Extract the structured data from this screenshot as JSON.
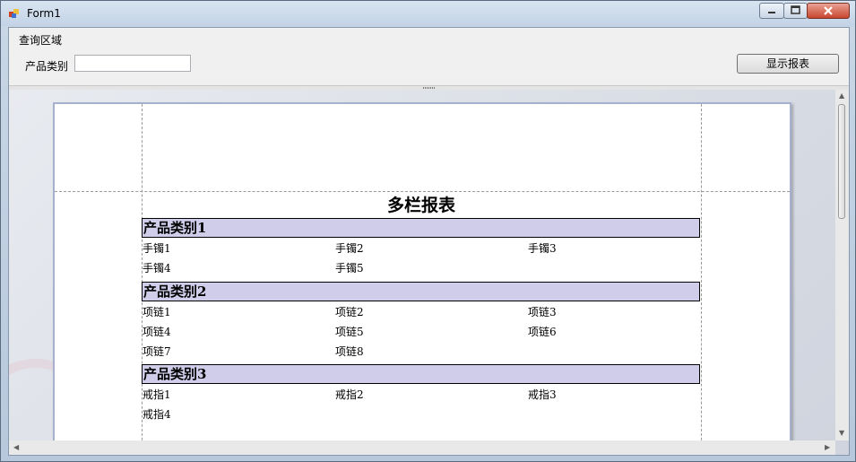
{
  "window": {
    "title": "Form1"
  },
  "query": {
    "group_title": "查询区域",
    "field_label": "产品类别",
    "field_value": "",
    "button_label": "显示报表"
  },
  "report": {
    "title": "多栏报表",
    "groups": [
      {
        "header": "产品类别1",
        "items": [
          "手镯1",
          "手镯2",
          "手镯3",
          "手镯4",
          "手镯5"
        ]
      },
      {
        "header": "产品类别2",
        "items": [
          "项链1",
          "项链2",
          "项链3",
          "项链4",
          "项链5",
          "项链6",
          "项链7",
          "项链8"
        ]
      },
      {
        "header": "产品类别3",
        "items": [
          "戒指1",
          "戒指2",
          "戒指3",
          "戒指4"
        ]
      }
    ]
  }
}
